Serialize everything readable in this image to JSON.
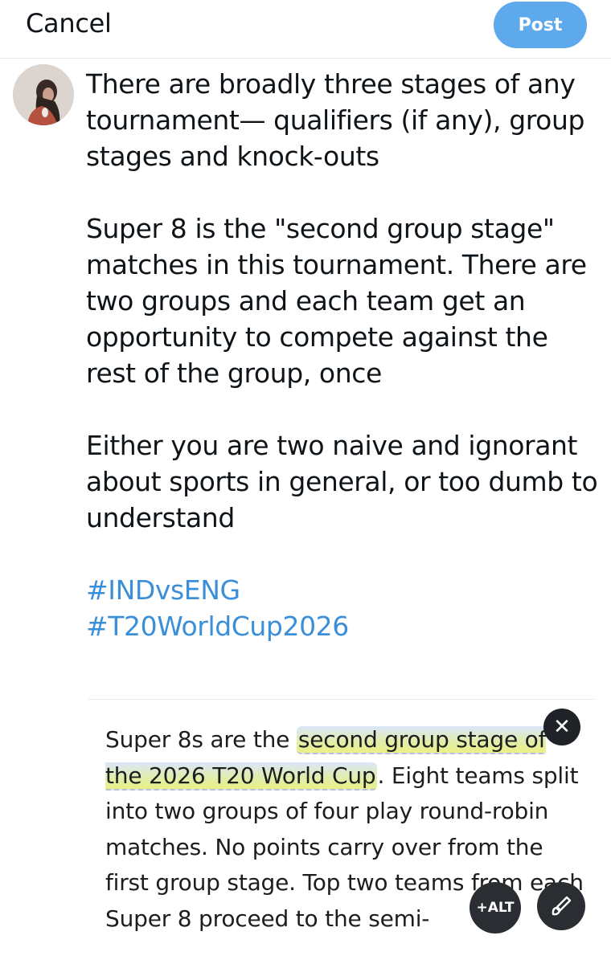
{
  "header": {
    "cancel_label": "Cancel",
    "post_label": "Post",
    "accent_color": "#5ea8ec"
  },
  "avatar": {
    "icon": "user-avatar"
  },
  "compose": {
    "paragraph_1": "There are broadly three stages of any tournament— qualifiers (if any), group stages and knock-outs",
    "paragraph_2": "Super 8 is the \"second group stage\" matches in this tournament. There are two groups and each team get an opportunity to compete against the rest of the group, once",
    "paragraph_3": "Either you are two naive and ignorant about sports in general, or too dumb to understand",
    "hashtags": [
      "#INDvsENG",
      "#T20WorldCup2026"
    ],
    "hashtag_color": "#3b8fd9"
  },
  "attachment": {
    "text_before": "Super 8s are the ",
    "highlighted_text": "second group stage of the 2026 T20 World Cup",
    "text_after": ". Eight teams split into two groups of four play round-robin matches. No points carry over from the first group stage. Top two teams from each Super 8 proceed to the semi-",
    "close_icon": "close-icon",
    "alt_label": "+ALT",
    "edit_icon": "paintbrush-icon"
  }
}
